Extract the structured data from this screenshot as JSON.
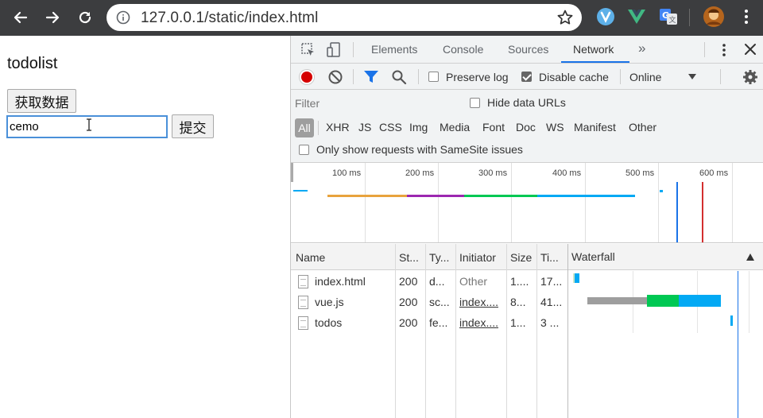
{
  "browser": {
    "url": "127.0.0.1/static/index.html"
  },
  "page": {
    "title": "todolist",
    "fetch_button": "获取数据",
    "input_value": "cemo",
    "submit_button": "提交"
  },
  "devtools": {
    "tabs": [
      "Elements",
      "Console",
      "Sources",
      "Network"
    ],
    "active_tab": "Network",
    "more_tabs": "»",
    "toolbar": {
      "preserve_log": "Preserve log",
      "preserve_log_checked": false,
      "disable_cache": "Disable cache",
      "disable_cache_checked": true,
      "throttle": "Online"
    },
    "filter": {
      "placeholder": "Filter",
      "hide_data_urls": "Hide data URLs",
      "types": [
        "All",
        "XHR",
        "JS",
        "CSS",
        "Img",
        "Media",
        "Font",
        "Doc",
        "WS",
        "Manifest",
        "Other"
      ],
      "samesite": "Only show requests with SameSite issues"
    },
    "overview": {
      "ticks": [
        "100 ms",
        "200 ms",
        "300 ms",
        "400 ms",
        "500 ms",
        "600 ms"
      ]
    },
    "table": {
      "headers": [
        "Name",
        "St...",
        "Ty...",
        "Initiator",
        "Size",
        "Ti...",
        "Waterfall"
      ],
      "rows": [
        {
          "name": "index.html",
          "status": "200",
          "type": "d...",
          "initiator": "Other",
          "size": "1....",
          "time": "17..."
        },
        {
          "name": "vue.js",
          "status": "200",
          "type": "sc...",
          "initiator": "index....",
          "size": "8...",
          "time": "41..."
        },
        {
          "name": "todos",
          "status": "200",
          "type": "fe...",
          "initiator": "index....",
          "size": "1...",
          "time": "3 ..."
        }
      ]
    },
    "colors": {
      "accent": "#1a73e8",
      "record": "#d50000",
      "waterfall_green": "#00c853",
      "waterfall_blue": "#03a9f4",
      "waterfall_orange": "#e8a33d",
      "waterfall_purple": "#9c27b0"
    }
  }
}
